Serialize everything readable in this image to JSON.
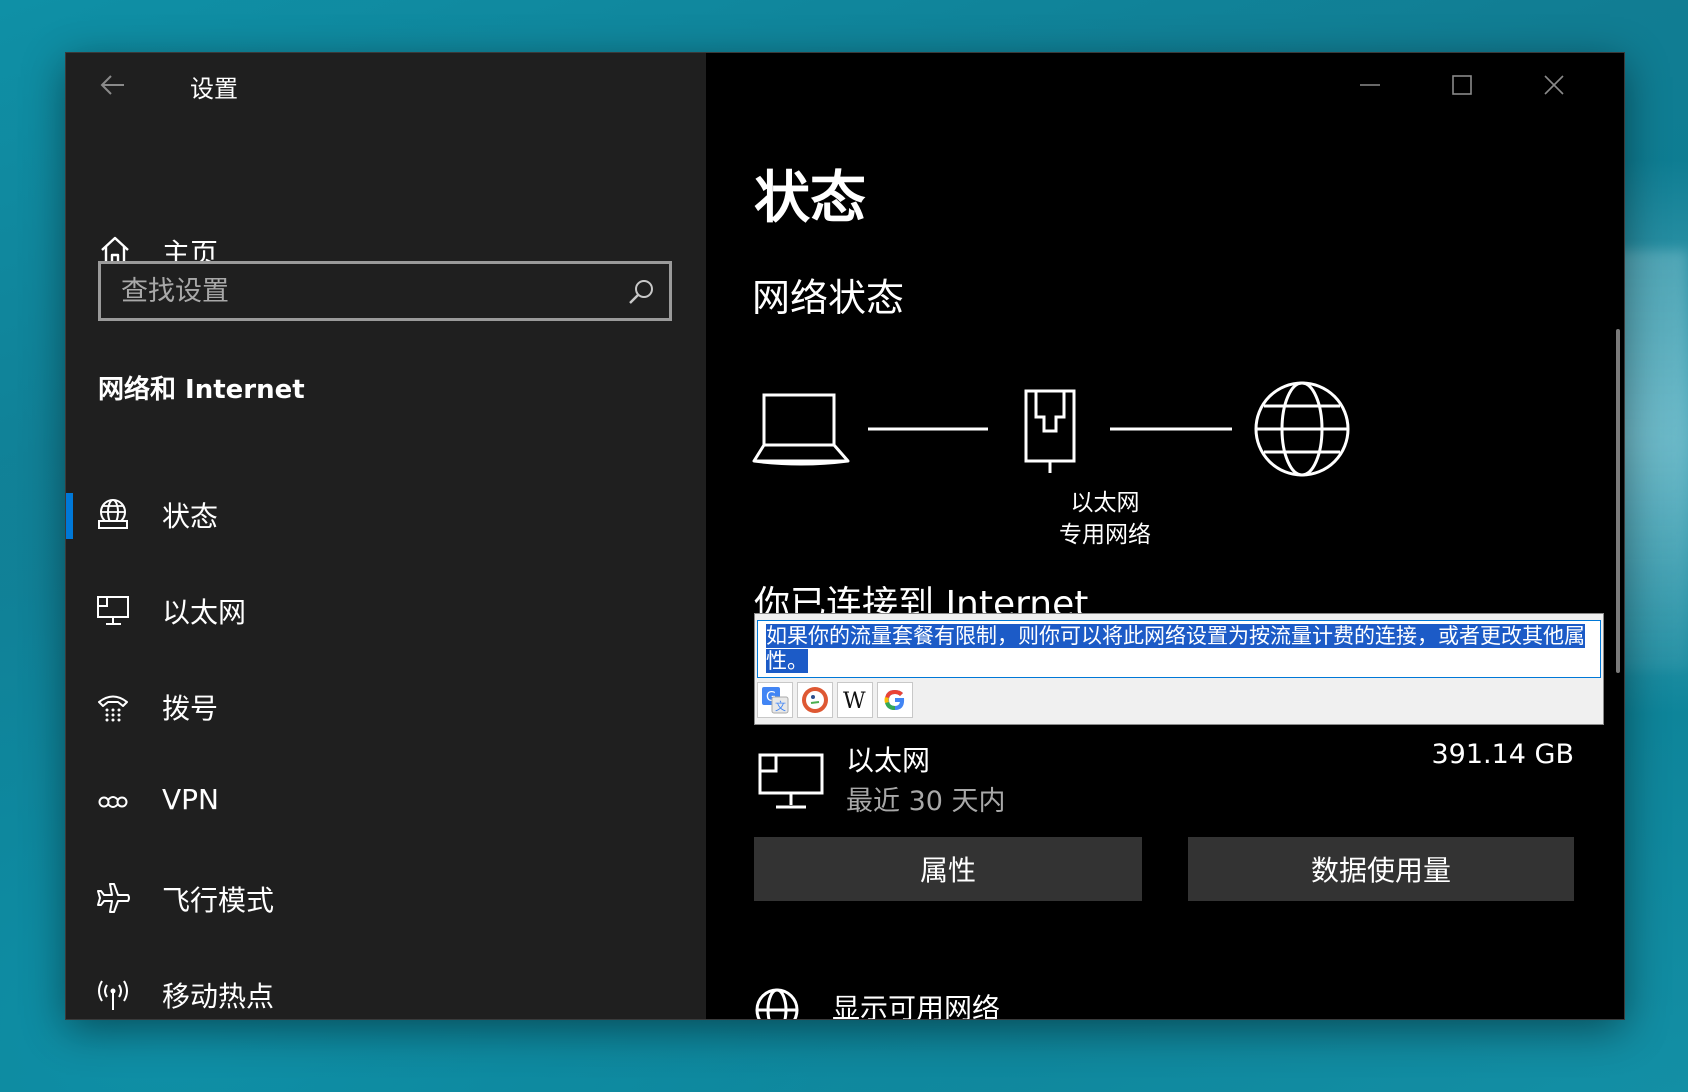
{
  "window": {
    "app_title": "设置"
  },
  "sidebar": {
    "home_label": "主页",
    "search_placeholder": "查找设置",
    "section_title": "网络和 Internet",
    "items": [
      {
        "label": "状态",
        "icon": "globe-status-icon",
        "active": true
      },
      {
        "label": "以太网",
        "icon": "ethernet-icon",
        "active": false
      },
      {
        "label": "拨号",
        "icon": "dialup-icon",
        "active": false
      },
      {
        "label": "VPN",
        "icon": "vpn-icon",
        "active": false
      },
      {
        "label": "飞行模式",
        "icon": "airplane-icon",
        "active": false
      },
      {
        "label": "移动热点",
        "icon": "hotspot-icon",
        "active": false
      }
    ]
  },
  "content": {
    "page_title": "状态",
    "network_status_title": "网络状态",
    "diagram": {
      "adapter_label": "以太网",
      "network_label": "专用网络"
    },
    "connected_text": "你已连接到 Internet",
    "popup": {
      "selected_text": "如果你的流量套餐有限制，则你可以将此网络设置为按流量计费的连接，或者更改其他属性。",
      "icons": [
        "google-translate-icon",
        "duckduckgo-icon",
        "wikipedia-icon",
        "google-icon"
      ]
    },
    "usage": {
      "name": "以太网",
      "period": "最近 30 天内",
      "amount": "391.14 GB"
    },
    "buttons": {
      "properties": "属性",
      "data_usage": "数据使用量"
    },
    "show_networks": "显示可用网络"
  },
  "colors": {
    "accent": "#0078d7",
    "sidebar_bg": "#1f1f1f",
    "content_bg": "#000000",
    "button_bg": "#333333"
  }
}
